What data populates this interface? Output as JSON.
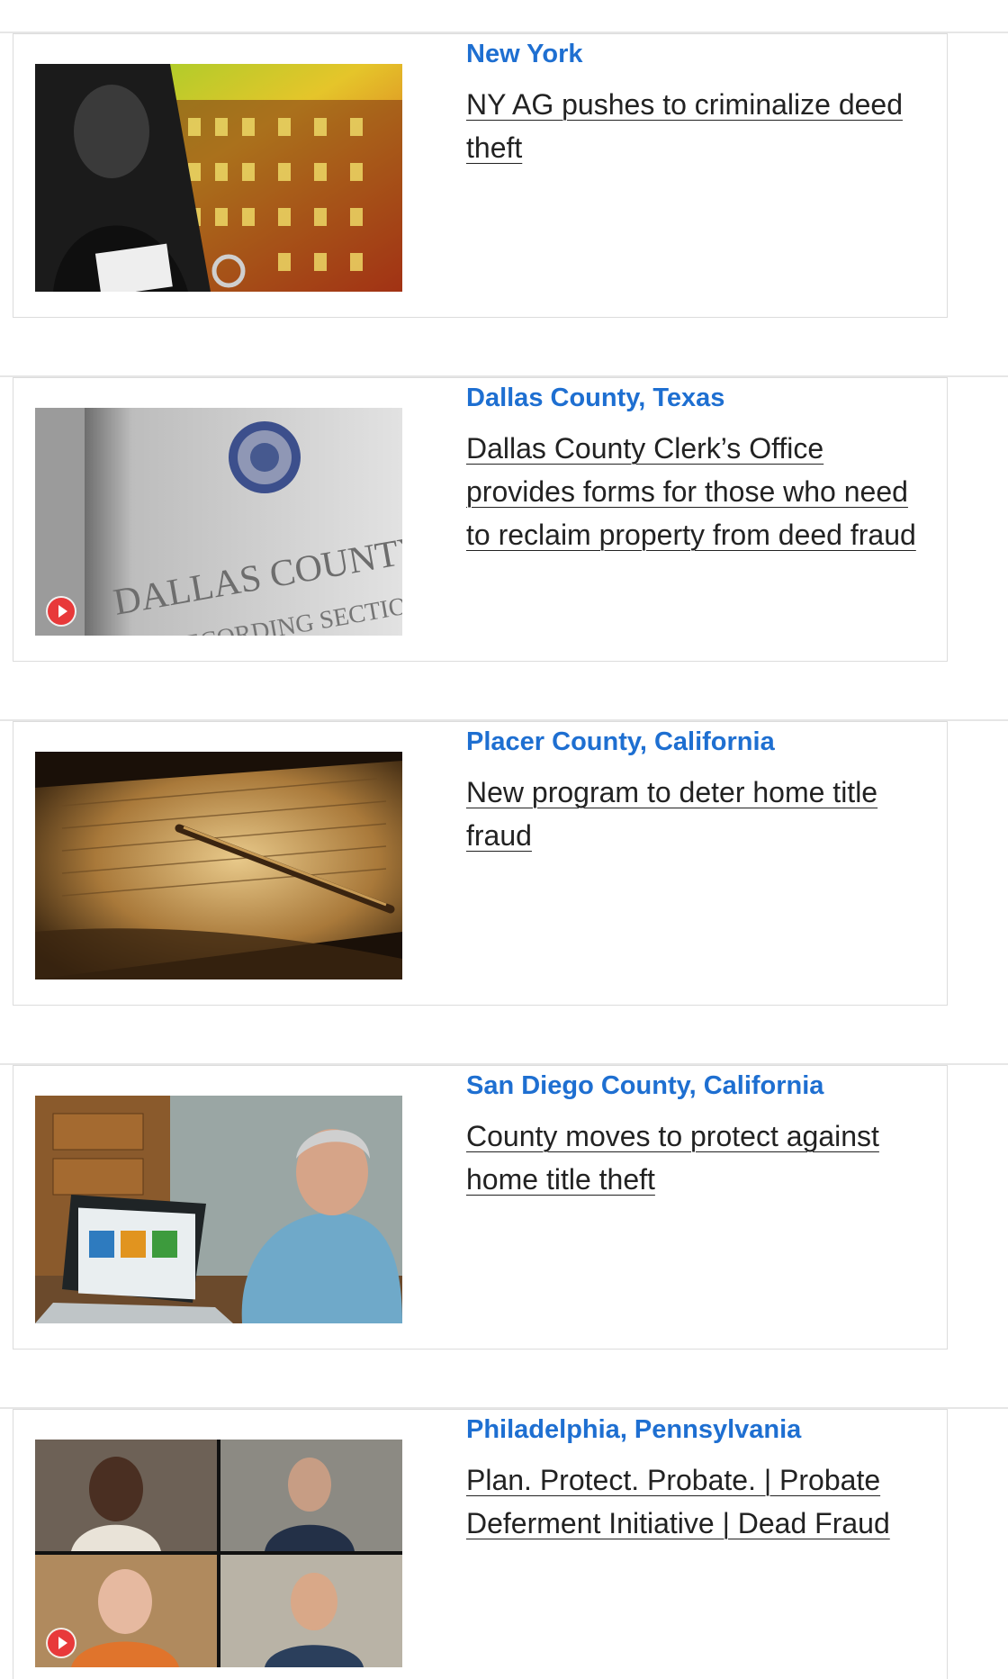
{
  "articles": [
    {
      "location": "New York",
      "title": "NY AG pushes to criminalize deed theft",
      "has_video": false,
      "image_desc": "ny-ag-collage"
    },
    {
      "location": "Dallas County, Texas",
      "title": "Dallas County Clerk’s Office provides forms for those who need to reclaim property from deed fraud",
      "has_video": true,
      "image_desc": "dallas-county-clerk-sign",
      "image_text": [
        "DALLAS COUNTY CLERK",
        "RECORDING SECTION"
      ]
    },
    {
      "location": "Placer County, California",
      "title": "New program to deter home title fraud",
      "has_video": false,
      "image_desc": "old-deed-with-pen"
    },
    {
      "location": "San Diego County, California",
      "title": "County moves to protect against home title theft",
      "has_video": false,
      "image_desc": "man-at-laptop"
    },
    {
      "location": "Philadelphia, Pennsylvania",
      "title": "Plan. Protect. Probate. | Probate Deferment Initiative | Dead Fraud",
      "has_video": true,
      "image_desc": "video-call-grid"
    }
  ],
  "colors": {
    "location": "#1e6fd1",
    "title": "#222222",
    "card_border": "#dcdcdc",
    "play_button": "#e8393a"
  },
  "icons": {
    "play": "play-button-icon"
  }
}
